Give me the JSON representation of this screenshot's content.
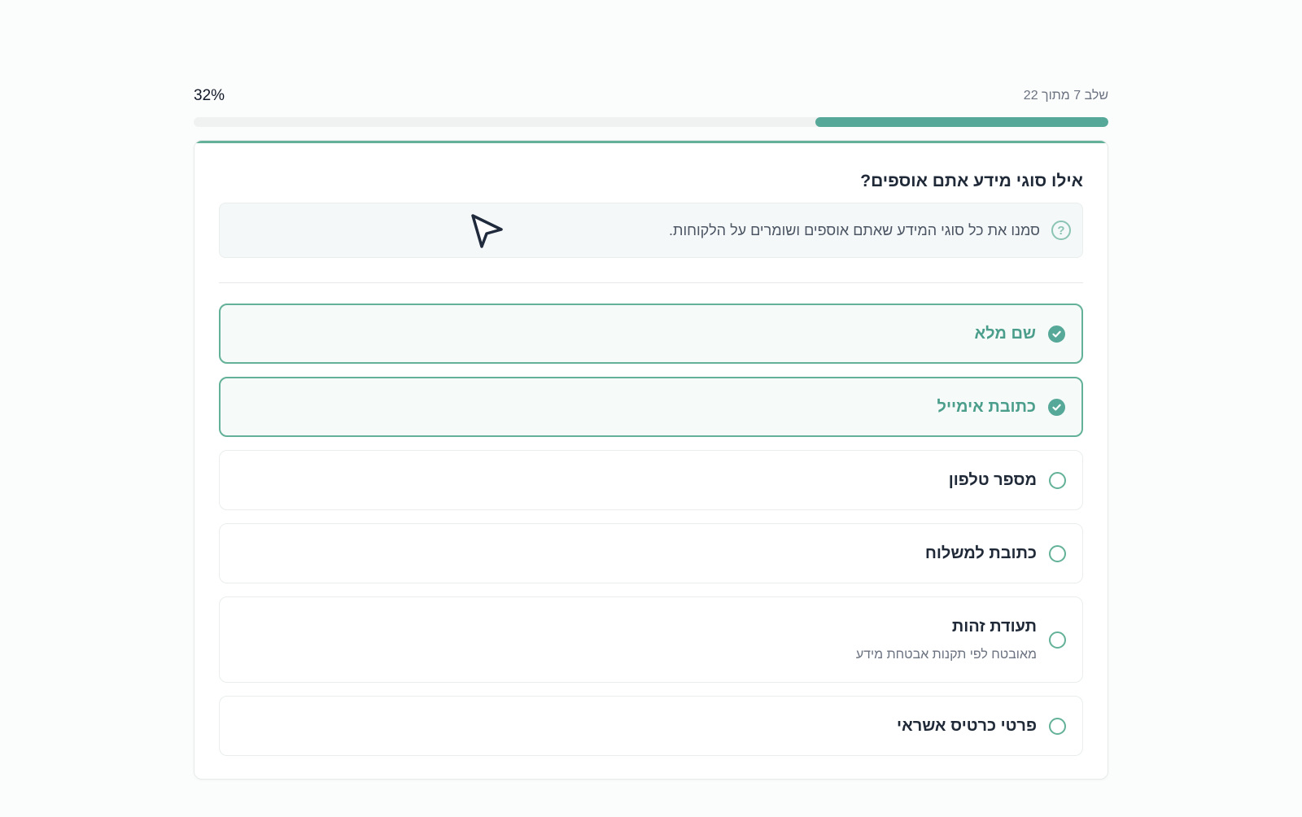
{
  "progress": {
    "step_label": "שלב 7 מתוך 22",
    "percent_label": "32%",
    "percent": 32
  },
  "question": {
    "title": "אילו סוגי מידע אתם אוספים?",
    "hint_icon": "question-circle-icon",
    "hint": "סמנו את כל סוגי המידע שאתם אוספים ושומרים על הלקוחות."
  },
  "options": [
    {
      "label": "שם מלא",
      "selected": true
    },
    {
      "label": "כתובת אימייל",
      "selected": true
    },
    {
      "label": "מספר טלפון",
      "selected": false
    },
    {
      "label": "כתובת למשלוח",
      "selected": false
    },
    {
      "label": "תעודת זהות",
      "sublabel": "מאובטח לפי תקנות אבטחת מידע",
      "selected": false
    },
    {
      "label": "פרטי כרטיס אשראי",
      "selected": false
    }
  ],
  "colors": {
    "accent": "#56a898",
    "selected_text": "#4b9e8b"
  }
}
